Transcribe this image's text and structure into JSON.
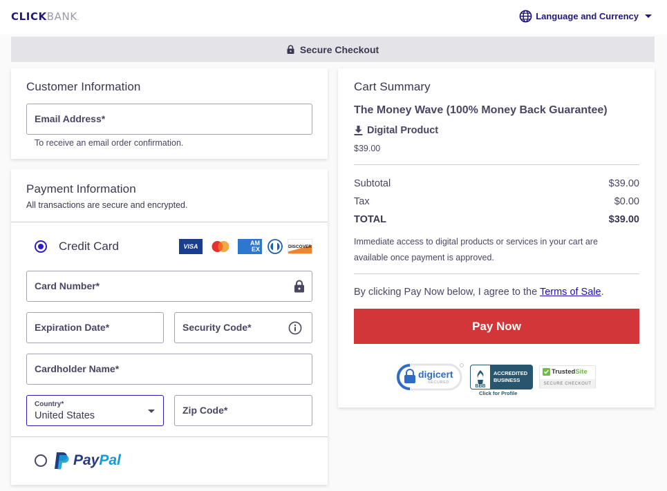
{
  "header": {
    "logo_click": "CLICK",
    "logo_bank": "BANK",
    "logo_dot": ".",
    "language_label": "Language and Currency",
    "icons": {
      "language": "globe-icon",
      "dropdown": "caret-down-icon"
    }
  },
  "secure_bar": {
    "label": "Secure Checkout",
    "icon": "lock-icon"
  },
  "customer": {
    "title": "Customer Information",
    "email_label": "Email Address*",
    "email_value": "",
    "email_hint": "To receive an email order confirmation."
  },
  "payment": {
    "title": "Payment Information",
    "subtitle": "All transactions are secure and encrypted.",
    "methods": [
      {
        "label": "Credit Card",
        "selected": true
      },
      {
        "label": "PayPal",
        "selected": false
      }
    ],
    "card_brands": [
      "VISA",
      "Mastercard",
      "AMEX",
      "Diners Club",
      "DISCOVER"
    ],
    "card_brand_text": {
      "visa": "VISA",
      "amex_top": "AM",
      "amex_bottom": "EX",
      "discover": "DISCOVER"
    },
    "paypal_text": {
      "pay": "Pay",
      "pal": "Pal"
    },
    "fields": {
      "card_number": "Card Number*",
      "expiration": "Expiration Date*",
      "security_code": "Security Code*",
      "cardholder": "Cardholder Name*",
      "country_label": "Country*",
      "country_value": "United States",
      "zip": "Zip Code*"
    }
  },
  "cart": {
    "title": "Cart Summary",
    "product_name": "The Money Wave (100% Money Back Guarantee)",
    "product_type": "Digital Product",
    "product_price": "$39.00",
    "lines": [
      {
        "label": "Subtotal",
        "value": "$39.00"
      },
      {
        "label": "Tax",
        "value": "$0.00"
      },
      {
        "label": "TOTAL",
        "value": "$39.00"
      }
    ],
    "access_note": "Immediate access to digital products or services in your cart are available once payment is approved.",
    "agree_prefix": "By clicking Pay Now below, I agree to the ",
    "terms_link": "Terms of Sale",
    "agree_suffix": ".",
    "pay_button": "Pay Now",
    "badges": {
      "digicert": "digicert",
      "digicert_sub": "SECURED",
      "bbb_line1": "ACCREDITED",
      "bbb_line2": "BUSINESS",
      "bbb_mark": "BBB",
      "bbb_link": "Click for Profile",
      "trusted_a": "Trusted",
      "trusted_b": "Site",
      "trusted_sub": "SECURE CHECKOUT"
    }
  },
  "colors": {
    "brand": "#22177a",
    "pay_button": "#d23639",
    "radio_selected": "#2c1cc8",
    "link": "#1b0fb5",
    "paypal_dark": "#253b80",
    "paypal_light": "#179bd7"
  }
}
